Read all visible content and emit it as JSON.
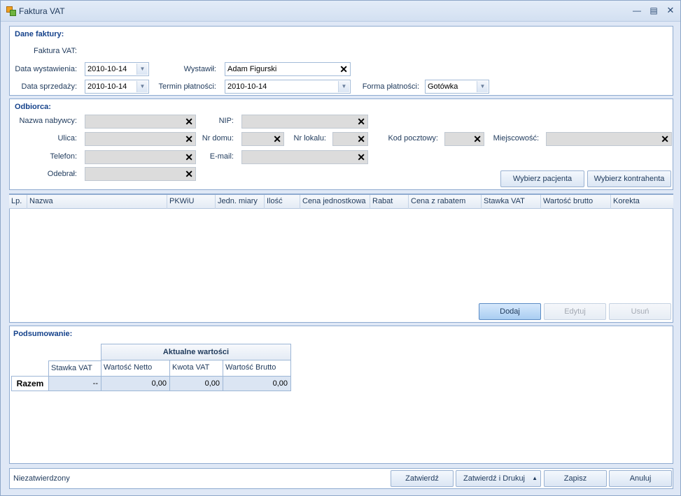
{
  "window": {
    "title": "Faktura VAT"
  },
  "invoice": {
    "section_title": "Dane faktury:",
    "type_label": "Faktura VAT:",
    "issue_date_label": "Data wystawienia:",
    "issue_date": "2010-10-14",
    "sale_date_label": "Data sprzedaży:",
    "sale_date": "2010-10-14",
    "issuer_label": "Wystawił:",
    "issuer": "Adam Figurski",
    "payment_term_label": "Termin płatności:",
    "payment_term": "2010-10-14",
    "payment_form_label": "Forma płatności:",
    "payment_form": "Gotówka"
  },
  "recipient": {
    "section_title": "Odbiorca:",
    "buyer_name_label": "Nazwa nabywcy:",
    "nip_label": "NIP:",
    "street_label": "Ulica:",
    "house_no_label": "Nr domu:",
    "flat_no_label": "Nr lokalu:",
    "postal_code_label": "Kod pocztowy:",
    "city_label": "Miejscowość:",
    "phone_label": "Telefon:",
    "email_label": "E-mail:",
    "received_by_label": "Odebrał:",
    "choose_patient_label": "Wybierz pacjenta",
    "choose_contractor_label": "Wybierz kontrahenta"
  },
  "items_grid": {
    "columns": [
      "Lp.",
      "Nazwa",
      "PKWiU",
      "Jedn. miary",
      "Ilość",
      "Cena jednostkowa",
      "Rabat",
      "Cena z rabatem",
      "Stawka VAT",
      "Wartość brutto",
      "Korekta"
    ],
    "add_label": "Dodaj",
    "edit_label": "Edytuj",
    "delete_label": "Usuń"
  },
  "summary": {
    "section_title": "Podsumowanie:",
    "group_header": "Aktualne wartości",
    "headers": [
      "Stawka VAT",
      "Wartość Netto",
      "Kwota VAT",
      "Wartość Brutto"
    ],
    "row_label": "Razem",
    "row_values": [
      "--",
      "0,00",
      "0,00",
      "0,00"
    ]
  },
  "footer": {
    "status": "Niezatwierdzony",
    "confirm_label": "Zatwierdź",
    "confirm_print_label": "Zatwierdź i Drukuj",
    "save_label": "Zapisz",
    "cancel_label": "Anuluj"
  },
  "colors": {
    "accent": "#15428b",
    "border": "#8fabd0",
    "background": "#dfe8f6"
  }
}
